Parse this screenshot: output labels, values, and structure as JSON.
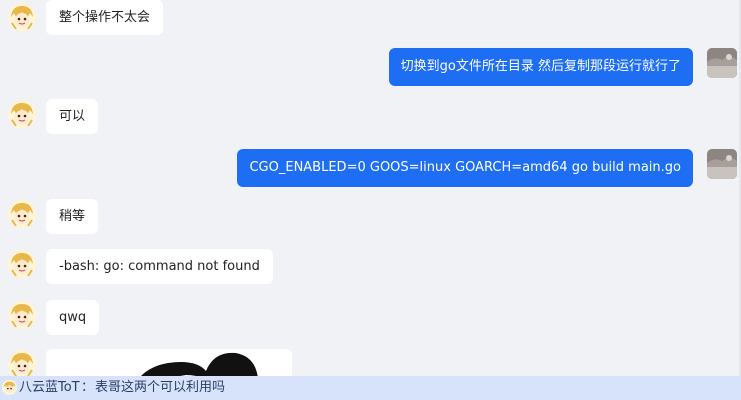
{
  "messages": [
    {
      "side": "in",
      "text": "整个操作不太会"
    },
    {
      "side": "out",
      "text": "切换到go文件所在目录 然后复制那段运行就行了"
    },
    {
      "side": "in",
      "text": "可以"
    },
    {
      "side": "out",
      "text": "CGO_ENABLED=0 GOOS=linux GOARCH=amd64 go build main.go"
    },
    {
      "side": "in",
      "text": "稍等"
    },
    {
      "side": "in",
      "text": "-bash: go: command not found"
    },
    {
      "side": "in",
      "text": "qwq"
    },
    {
      "side": "in",
      "type": "image",
      "icon": "panda-sticker"
    }
  ],
  "reply_preview": {
    "name": "八云蓝ToT",
    "separator": "：",
    "text": "表哥这两个可以利用吗"
  },
  "colors": {
    "outgoing_bubble": "#1e6ef4",
    "incoming_bubble": "#ffffff",
    "background": "#f1f2f6",
    "preview_bar": "#d6e3fb"
  }
}
